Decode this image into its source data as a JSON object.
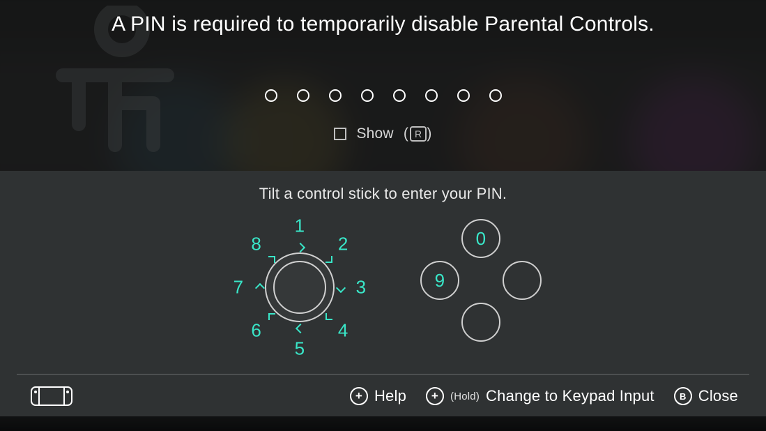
{
  "title": "A PIN is required to temporarily disable Parental Controls.",
  "pin": {
    "length": 8,
    "show_label": "Show",
    "show_button_glyph": "R",
    "show_checked": false
  },
  "instruction": "Tilt a control stick to enter your PIN.",
  "stick_numbers": [
    "1",
    "2",
    "3",
    "4",
    "5",
    "6",
    "7",
    "8"
  ],
  "dpad": {
    "top": {
      "label": "0",
      "visible": true
    },
    "left": {
      "label": "9",
      "visible": true
    },
    "right": {
      "label": "",
      "visible": true
    },
    "bottom": {
      "label": "",
      "visible": true
    }
  },
  "footer": {
    "help": {
      "glyph": "plus",
      "label": "Help"
    },
    "keypad": {
      "glyph": "plus",
      "hold_prefix": "(Hold)",
      "label": "Change to Keypad Input"
    },
    "close": {
      "glyph": "B",
      "label": "Close"
    }
  },
  "colors": {
    "accent": "#39e6c8",
    "panel": "#2f3233"
  }
}
